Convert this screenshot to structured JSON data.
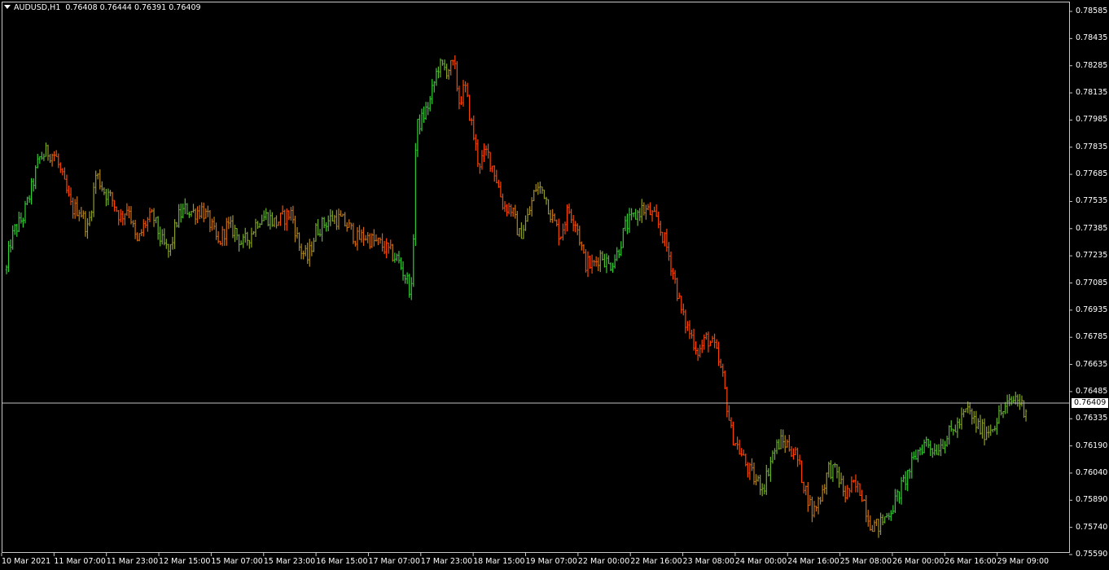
{
  "header": {
    "symbol_timeframe": "AUDUSD,H1",
    "ohlc": "0.76408 0.76444 0.76391 0.76409"
  },
  "current_price": "0.76409",
  "colors": {
    "background": "#000000",
    "bull": "#32cd32",
    "bear": "#ff4500",
    "axis_text": "#ffffff",
    "price_line": "#c0c0c0"
  },
  "y_ticks": [
    "0.78585",
    "0.78435",
    "0.78285",
    "0.78135",
    "0.77985",
    "0.77835",
    "0.77685",
    "0.77535",
    "0.77385",
    "0.77235",
    "0.77085",
    "0.76935",
    "0.76785",
    "0.76635",
    "0.76485",
    "0.76335",
    "0.76190",
    "0.76040",
    "0.75890",
    "0.75740",
    "0.75590"
  ],
  "x_ticks": [
    "10 Mar 2021",
    "11 Mar 07:00",
    "11 Mar 23:00",
    "12 Mar 15:00",
    "15 Mar 07:00",
    "15 Mar 23:00",
    "16 Mar 15:00",
    "17 Mar 07:00",
    "17 Mar 23:00",
    "18 Mar 15:00",
    "19 Mar 07:00",
    "22 Mar 00:00",
    "22 Mar 16:00",
    "23 Mar 08:00",
    "24 Mar 00:00",
    "24 Mar 16:00",
    "25 Mar 08:00",
    "26 Mar 00:00",
    "26 Mar 16:00",
    "29 Mar 09:00"
  ],
  "chart_data": {
    "type": "ohlc-bar",
    "symbol": "AUDUSD",
    "timeframe": "H1",
    "ylim": [
      0.7559,
      0.7865
    ],
    "anchors": [
      {
        "x": 0,
        "price": 0.7716
      },
      {
        "x": 4,
        "price": 0.773
      },
      {
        "x": 10,
        "price": 0.7738
      },
      {
        "x": 20,
        "price": 0.7745
      },
      {
        "x": 30,
        "price": 0.776
      },
      {
        "x": 40,
        "price": 0.7778
      },
      {
        "x": 50,
        "price": 0.7782
      },
      {
        "x": 60,
        "price": 0.778
      },
      {
        "x": 70,
        "price": 0.7765
      },
      {
        "x": 80,
        "price": 0.775
      },
      {
        "x": 90,
        "price": 0.775
      },
      {
        "x": 100,
        "price": 0.7738
      },
      {
        "x": 110,
        "price": 0.777
      },
      {
        "x": 120,
        "price": 0.776
      },
      {
        "x": 130,
        "price": 0.7755
      },
      {
        "x": 140,
        "price": 0.7745
      },
      {
        "x": 150,
        "price": 0.7752
      },
      {
        "x": 155,
        "price": 0.774
      },
      {
        "x": 160,
        "price": 0.773
      },
      {
        "x": 170,
        "price": 0.7742
      },
      {
        "x": 180,
        "price": 0.7746
      },
      {
        "x": 190,
        "price": 0.7732
      },
      {
        "x": 200,
        "price": 0.7725
      },
      {
        "x": 210,
        "price": 0.7745
      },
      {
        "x": 220,
        "price": 0.775
      },
      {
        "x": 230,
        "price": 0.7748
      },
      {
        "x": 240,
        "price": 0.775
      },
      {
        "x": 250,
        "price": 0.7742
      },
      {
        "x": 260,
        "price": 0.773
      },
      {
        "x": 270,
        "price": 0.774
      },
      {
        "x": 280,
        "price": 0.7738
      },
      {
        "x": 290,
        "price": 0.773
      },
      {
        "x": 300,
        "price": 0.7736
      },
      {
        "x": 310,
        "price": 0.7745
      },
      {
        "x": 320,
        "price": 0.7746
      },
      {
        "x": 330,
        "price": 0.7742
      },
      {
        "x": 340,
        "price": 0.7745
      },
      {
        "x": 350,
        "price": 0.7748
      },
      {
        "x": 360,
        "price": 0.7728
      },
      {
        "x": 370,
        "price": 0.7722
      },
      {
        "x": 380,
        "price": 0.7738
      },
      {
        "x": 390,
        "price": 0.7742
      },
      {
        "x": 400,
        "price": 0.7745
      },
      {
        "x": 410,
        "price": 0.7744
      },
      {
        "x": 420,
        "price": 0.774
      },
      {
        "x": 430,
        "price": 0.7733
      },
      {
        "x": 440,
        "price": 0.7735
      },
      {
        "x": 450,
        "price": 0.7732
      },
      {
        "x": 460,
        "price": 0.773
      },
      {
        "x": 470,
        "price": 0.7726
      },
      {
        "x": 480,
        "price": 0.7722
      },
      {
        "x": 490,
        "price": 0.7712
      },
      {
        "x": 498,
        "price": 0.7703
      },
      {
        "x": 503,
        "price": 0.7795
      },
      {
        "x": 510,
        "price": 0.78
      },
      {
        "x": 520,
        "price": 0.781
      },
      {
        "x": 530,
        "price": 0.783
      },
      {
        "x": 540,
        "price": 0.7828
      },
      {
        "x": 550,
        "price": 0.783
      },
      {
        "x": 556,
        "price": 0.781
      },
      {
        "x": 563,
        "price": 0.7818
      },
      {
        "x": 570,
        "price": 0.78
      },
      {
        "x": 580,
        "price": 0.7775
      },
      {
        "x": 590,
        "price": 0.7782
      },
      {
        "x": 600,
        "price": 0.777
      },
      {
        "x": 610,
        "price": 0.7752
      },
      {
        "x": 620,
        "price": 0.775
      },
      {
        "x": 630,
        "price": 0.7735
      },
      {
        "x": 640,
        "price": 0.7745
      },
      {
        "x": 650,
        "price": 0.7762
      },
      {
        "x": 660,
        "price": 0.776
      },
      {
        "x": 670,
        "price": 0.7745
      },
      {
        "x": 680,
        "price": 0.7735
      },
      {
        "x": 690,
        "price": 0.775
      },
      {
        "x": 700,
        "price": 0.7742
      },
      {
        "x": 710,
        "price": 0.772
      },
      {
        "x": 720,
        "price": 0.7718
      },
      {
        "x": 730,
        "price": 0.7725
      },
      {
        "x": 740,
        "price": 0.7718
      },
      {
        "x": 750,
        "price": 0.7725
      },
      {
        "x": 760,
        "price": 0.774
      },
      {
        "x": 770,
        "price": 0.7745
      },
      {
        "x": 780,
        "price": 0.775
      },
      {
        "x": 790,
        "price": 0.7748
      },
      {
        "x": 800,
        "price": 0.7742
      },
      {
        "x": 810,
        "price": 0.773
      },
      {
        "x": 820,
        "price": 0.7712
      },
      {
        "x": 830,
        "price": 0.769
      },
      {
        "x": 840,
        "price": 0.768
      },
      {
        "x": 850,
        "price": 0.767
      },
      {
        "x": 860,
        "price": 0.7678
      },
      {
        "x": 870,
        "price": 0.7672
      },
      {
        "x": 880,
        "price": 0.7655
      },
      {
        "x": 890,
        "price": 0.7625
      },
      {
        "x": 900,
        "price": 0.7615
      },
      {
        "x": 910,
        "price": 0.7605
      },
      {
        "x": 920,
        "price": 0.7598
      },
      {
        "x": 930,
        "price": 0.7595
      },
      {
        "x": 940,
        "price": 0.7612
      },
      {
        "x": 950,
        "price": 0.762
      },
      {
        "x": 960,
        "price": 0.7618
      },
      {
        "x": 970,
        "price": 0.7612
      },
      {
        "x": 980,
        "price": 0.7595
      },
      {
        "x": 990,
        "price": 0.758
      },
      {
        "x": 1000,
        "price": 0.759
      },
      {
        "x": 1010,
        "price": 0.7605
      },
      {
        "x": 1020,
        "price": 0.7602
      },
      {
        "x": 1030,
        "price": 0.759
      },
      {
        "x": 1040,
        "price": 0.7595
      },
      {
        "x": 1050,
        "price": 0.7592
      },
      {
        "x": 1060,
        "price": 0.7575
      },
      {
        "x": 1070,
        "price": 0.7572
      },
      {
        "x": 1080,
        "price": 0.7578
      },
      {
        "x": 1090,
        "price": 0.7585
      },
      {
        "x": 1100,
        "price": 0.7595
      },
      {
        "x": 1110,
        "price": 0.7605
      },
      {
        "x": 1120,
        "price": 0.7615
      },
      {
        "x": 1130,
        "price": 0.762
      },
      {
        "x": 1140,
        "price": 0.7615
      },
      {
        "x": 1150,
        "price": 0.762
      },
      {
        "x": 1160,
        "price": 0.7625
      },
      {
        "x": 1170,
        "price": 0.763
      },
      {
        "x": 1180,
        "price": 0.7638
      },
      {
        "x": 1190,
        "price": 0.763
      },
      {
        "x": 1200,
        "price": 0.7625
      },
      {
        "x": 1210,
        "price": 0.7628
      },
      {
        "x": 1220,
        "price": 0.7635
      },
      {
        "x": 1230,
        "price": 0.764
      },
      {
        "x": 1240,
        "price": 0.7645
      },
      {
        "x": 1250,
        "price": 0.7638
      },
      {
        "x": 1258,
        "price": 0.7641
      }
    ]
  }
}
